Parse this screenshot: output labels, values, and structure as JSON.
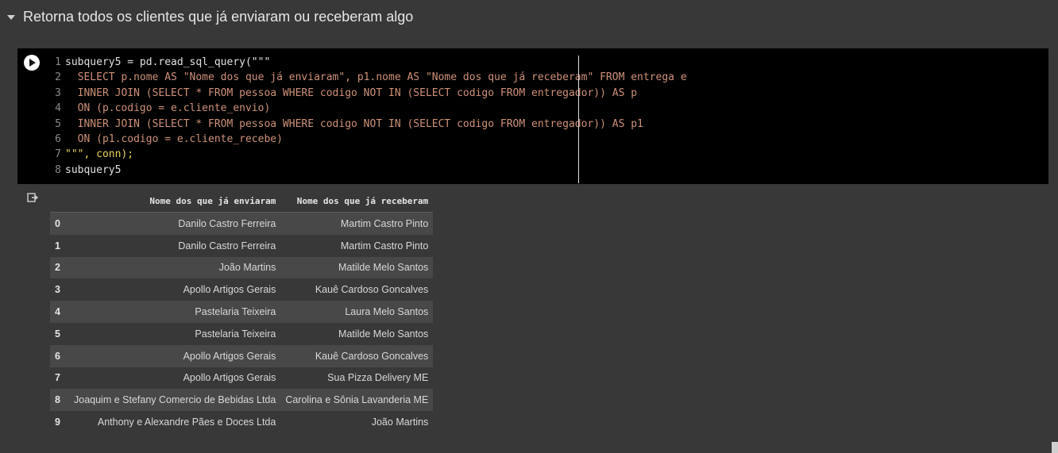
{
  "section": {
    "title": "Retorna todos os clientes que já enviaram ou receberam algo"
  },
  "code": {
    "lines": [
      {
        "num": "1",
        "text": "subquery5 = pd.read_sql_query(\"\"\""
      },
      {
        "num": "2",
        "text": "  SELECT p.nome AS \"Nome dos que já enviaram\", p1.nome AS \"Nome dos que já receberam\" FROM entrega e"
      },
      {
        "num": "3",
        "text": "  INNER JOIN (SELECT * FROM pessoa WHERE codigo NOT IN (SELECT codigo FROM entregador)) AS p"
      },
      {
        "num": "4",
        "text": "  ON (p.codigo = e.cliente_envio)"
      },
      {
        "num": "5",
        "text": "  INNER JOIN (SELECT * FROM pessoa WHERE codigo NOT IN (SELECT codigo FROM entregador)) AS p1"
      },
      {
        "num": "6",
        "text": "  ON (p1.codigo = e.cliente_recebe)"
      },
      {
        "num": "7",
        "text": "\"\"\", conn);"
      },
      {
        "num": "8",
        "text": "subquery5"
      }
    ]
  },
  "output": {
    "columns": [
      "",
      "Nome dos que já enviaram",
      "Nome dos que já receberam"
    ],
    "rows": [
      [
        "0",
        "Danilo Castro Ferreira",
        "Martim Castro Pinto"
      ],
      [
        "1",
        "Danilo Castro Ferreira",
        "Martim Castro Pinto"
      ],
      [
        "2",
        "João Martins",
        "Matilde Melo Santos"
      ],
      [
        "3",
        "Apollo Artigos Gerais",
        "Kauê Cardoso Goncalves"
      ],
      [
        "4",
        "Pastelaria Teixeira",
        "Laura Melo Santos"
      ],
      [
        "5",
        "Pastelaria Teixeira",
        "Matilde Melo Santos"
      ],
      [
        "6",
        "Apollo Artigos Gerais",
        "Kauê Cardoso Goncalves"
      ],
      [
        "7",
        "Apollo Artigos Gerais",
        "Sua Pizza Delivery ME"
      ],
      [
        "8",
        "Joaquim e Stefany Comercio de Bebidas Ltda",
        "Carolina e Sônia Lavanderia ME"
      ],
      [
        "9",
        "Anthony e Alexandre Pães e Doces Ltda",
        "João Martins"
      ]
    ]
  },
  "icons": {
    "collapse": "chevron-down-icon",
    "run": "play-icon",
    "output": "output-redirect-icon"
  }
}
